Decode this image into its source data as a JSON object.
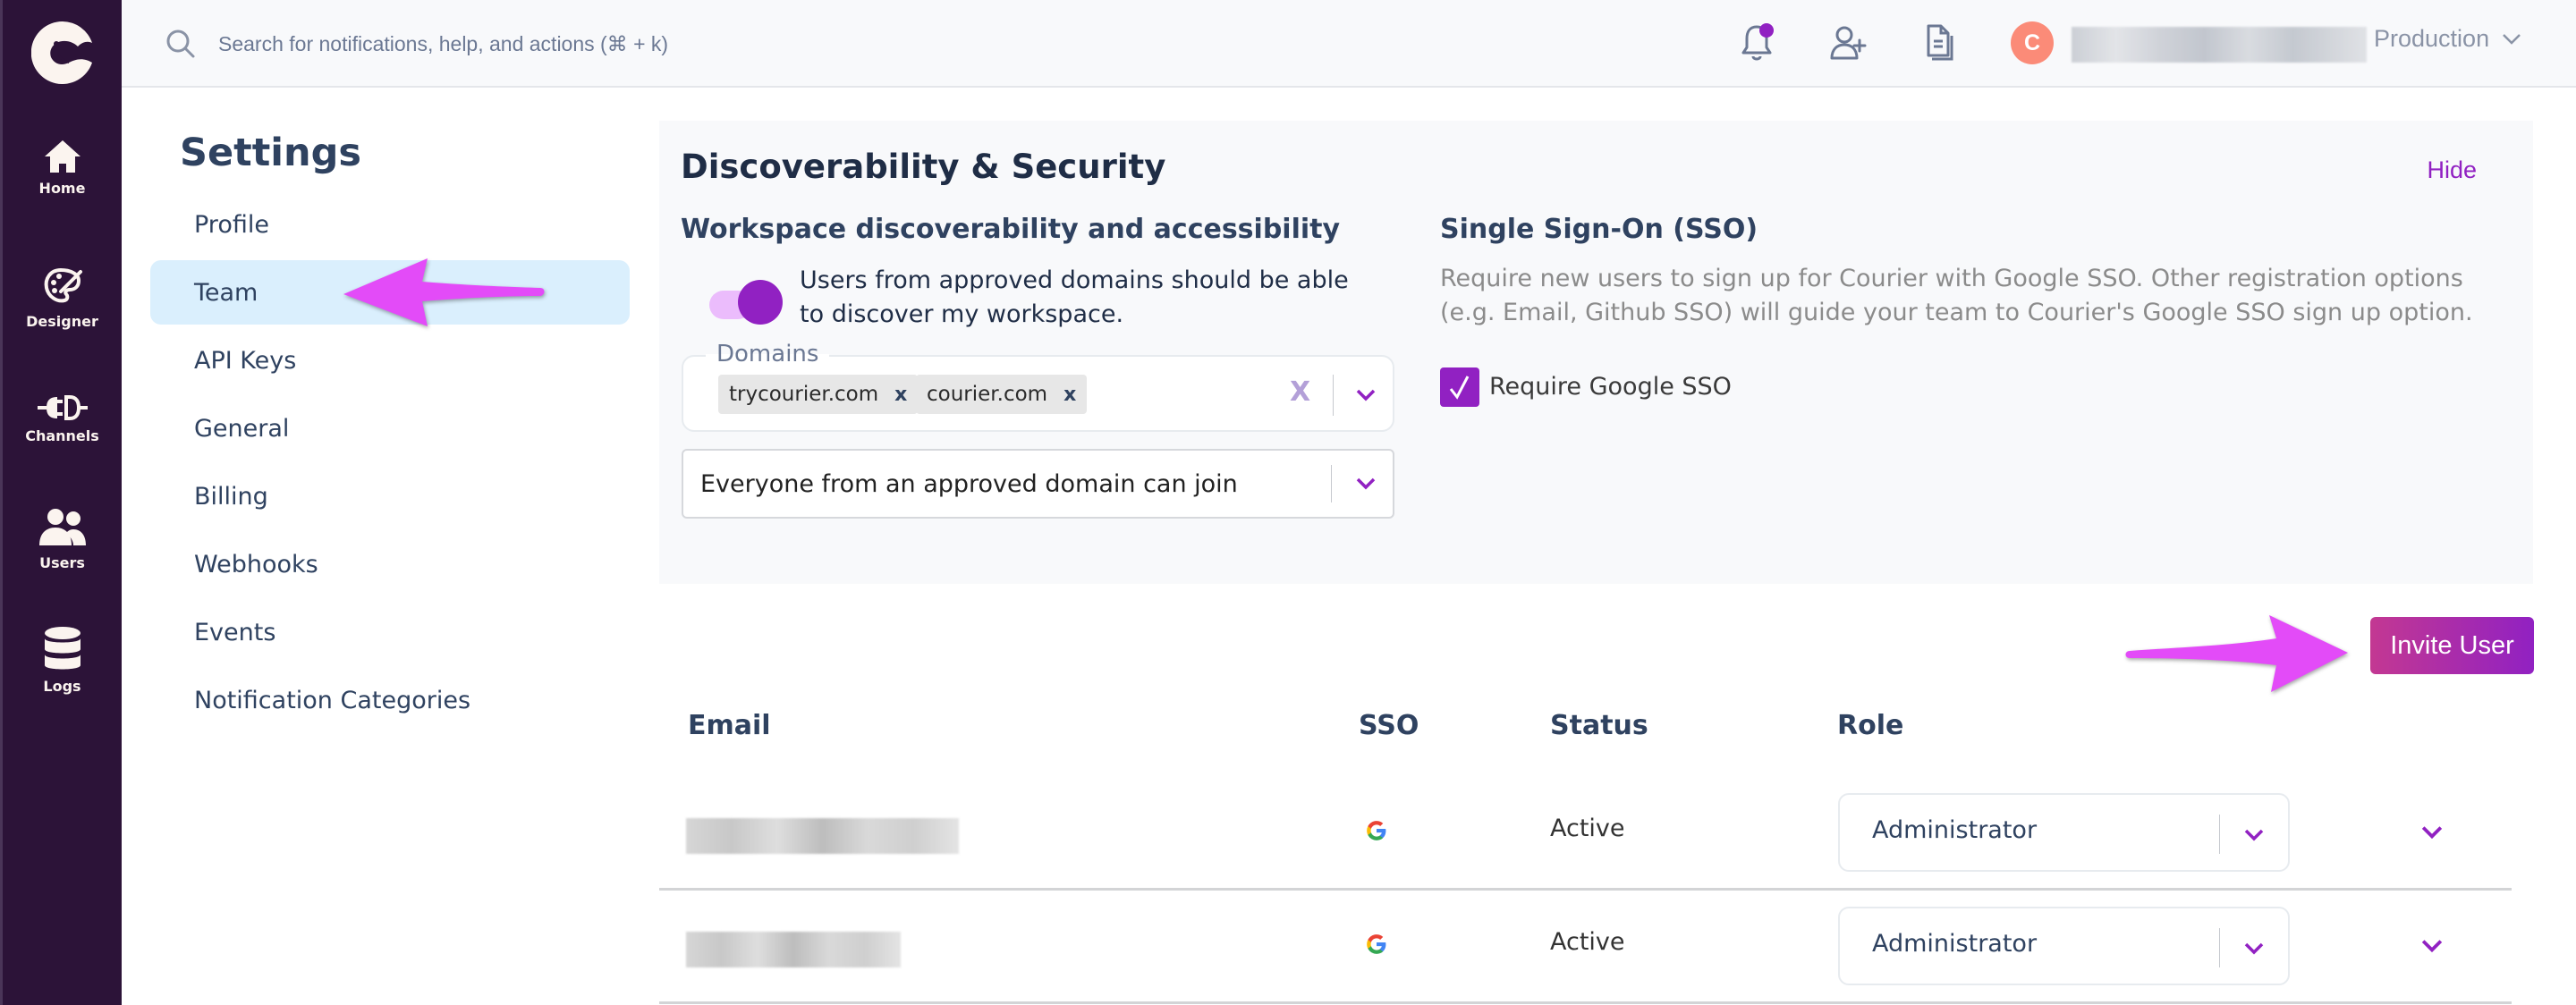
{
  "sidebar": {
    "logo": "courier-bird-logo",
    "items": [
      {
        "label": "Home",
        "icon": "home-icon"
      },
      {
        "label": "Designer",
        "icon": "palette-icon"
      },
      {
        "label": "Channels",
        "icon": "plug-icon"
      },
      {
        "label": "Users",
        "icon": "users-icon"
      },
      {
        "label": "Logs",
        "icon": "database-icon"
      }
    ]
  },
  "header": {
    "search_placeholder": "Search for notifications, help, and actions (⌘ + k)",
    "notification_badge": true,
    "avatar_initial": "C",
    "avatar_color": "#fb8b78",
    "environment": "Production"
  },
  "settings": {
    "title": "Settings",
    "nav": [
      {
        "label": "Profile",
        "active": false
      },
      {
        "label": "Team",
        "active": true
      },
      {
        "label": "API Keys",
        "active": false
      },
      {
        "label": "General",
        "active": false
      },
      {
        "label": "Billing",
        "active": false
      },
      {
        "label": "Webhooks",
        "active": false
      },
      {
        "label": "Events",
        "active": false
      },
      {
        "label": "Notification Categories",
        "active": false
      }
    ]
  },
  "discoverability": {
    "title": "Discoverability & Security",
    "hide_label": "Hide",
    "workspace": {
      "title": "Workspace discoverability and accessibility",
      "toggle_on": true,
      "toggle_label": "Users from approved domains should be able to discover my workspace.",
      "domains_label": "Domains",
      "domains": [
        "trycourier.com",
        "courier.com"
      ],
      "chip_remove": "x",
      "clear_all": "X",
      "join_policy": "Everyone from an approved domain can join"
    },
    "sso": {
      "title": "Single Sign-On (SSO)",
      "description": "Require new users to sign up for Courier with Google SSO. Other registration options (e.g. Email, Github SSO) will guide your team to Courier's Google SSO sign up option.",
      "require_checked": true,
      "require_label": "Require Google SSO"
    }
  },
  "team": {
    "invite_label": "Invite User",
    "columns": [
      "Email",
      "SSO",
      "Status",
      "Role"
    ],
    "rows": [
      {
        "email": "[redacted]",
        "sso": "google",
        "status": "Active",
        "role": "Administrator"
      },
      {
        "email": "[redacted]",
        "sso": "google",
        "status": "Active",
        "role": "Administrator"
      }
    ]
  },
  "colors": {
    "sidebar_bg": "#2c1338",
    "accent": "#9121c2",
    "accent_light": "#ebbcfc",
    "active_nav_bg": "#daeffd",
    "annotation_arrow": "#e34bf8",
    "invite_gradient_start": "#c33892",
    "invite_gradient_end": "#9121c2"
  },
  "annotations": [
    {
      "type": "arrow",
      "points_to": "Team"
    },
    {
      "type": "arrow",
      "points_to": "Invite User"
    }
  ]
}
